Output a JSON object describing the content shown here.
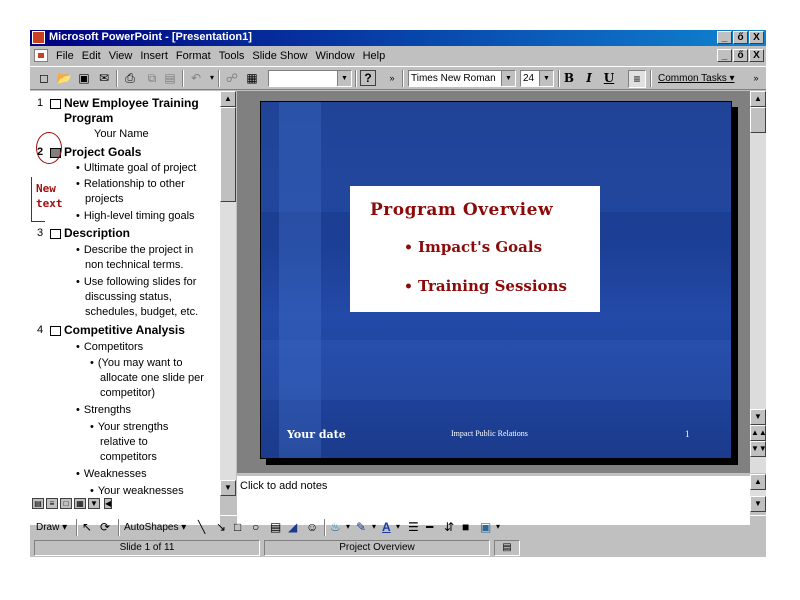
{
  "window": {
    "title": "Microsoft PowerPoint - [Presentation1]",
    "minimize": "_",
    "restore": "ő",
    "close": "X"
  },
  "menubar": {
    "items": [
      "File",
      "Edit",
      "View",
      "Insert",
      "Format",
      "Tools",
      "Slide Show",
      "Window",
      "Help"
    ]
  },
  "toolbar": {
    "font_name": "Times New Roman",
    "font_size": "24",
    "bold": "B",
    "italic": "I",
    "underline": "U",
    "common_tasks": "Common Tasks ▾",
    "zoom": ""
  },
  "outline": {
    "slides": [
      {
        "num": "1",
        "title": "New Employee Training",
        "title2": "Program",
        "subtitle": "Your Name"
      },
      {
        "num": "2",
        "title": "Project Goals",
        "bullets": [
          "Ultimate goal of project",
          "Relationship to other",
          "projects",
          "High-level timing goals"
        ]
      },
      {
        "num": "3",
        "title": "Description",
        "bullets": [
          "Describe the project in",
          "non technical terms.",
          "Use following slides for",
          "discussing status,",
          "schedules, budget, etc."
        ]
      },
      {
        "num": "4",
        "title": "Competitive Analysis",
        "bullets": [
          "Competitors",
          "(You may want to",
          "allocate one slide per",
          "competitor)",
          "Strengths",
          "Your strengths",
          "relative to",
          "competitors",
          "Weaknesses",
          "Your weaknesses"
        ]
      }
    ],
    "annotation": [
      "New",
      "text"
    ]
  },
  "slide": {
    "title": "Program Overview",
    "bullets": [
      "Impact's Goals",
      "Training Sessions"
    ],
    "footer_date": "Your date",
    "footer_center": "Impact Public Relations",
    "footer_number": "1"
  },
  "notes": {
    "placeholder": "Click to add notes"
  },
  "drawbar": {
    "draw": "Draw ▾",
    "autoshapes": "AutoShapes ▾"
  },
  "status": {
    "slide": "Slide 1 of 11",
    "design": "Project Overview"
  },
  "colors": {
    "slide_background": "#1c3f95",
    "title_text": "#8b0a0a",
    "annotation": "#a01010"
  }
}
